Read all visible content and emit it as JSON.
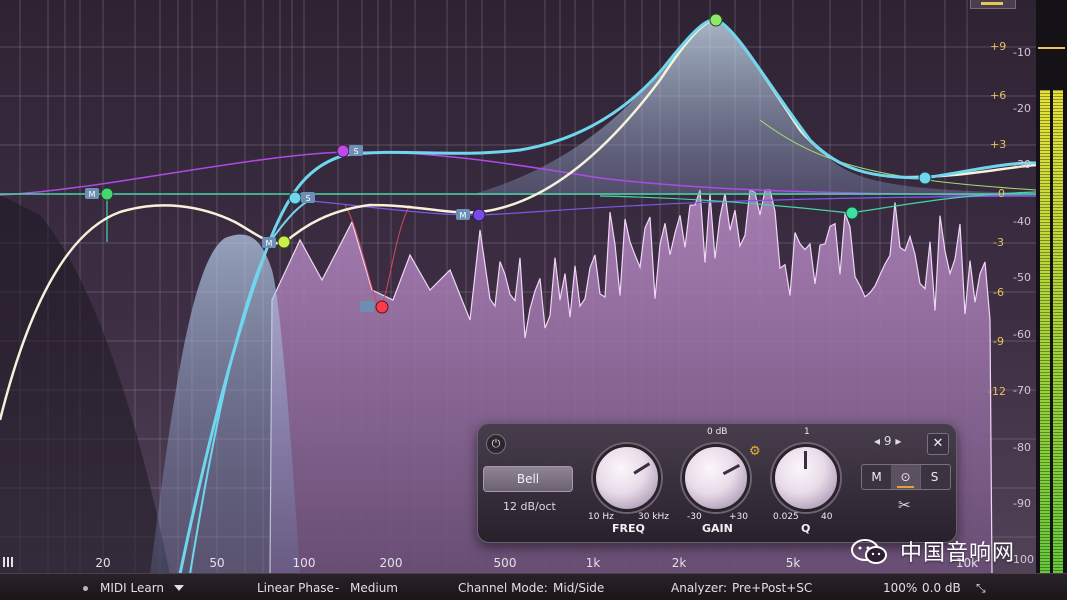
{
  "app": {
    "top_button": ""
  },
  "graph": {
    "x_ticks": [
      "20",
      "50",
      "100",
      "200",
      "500",
      "1k",
      "2k",
      "5k",
      "10k"
    ],
    "gain_ticks": [
      "+9",
      "+6",
      "+3",
      "0",
      "-3",
      "-6",
      "-9",
      "-12"
    ],
    "db_ticks": [
      "-10",
      "-20",
      "-30",
      "-40",
      "-50",
      "-60",
      "-70",
      "-80",
      "-90",
      "-100"
    ],
    "node_labels": {
      "band1": "M",
      "band2": "M",
      "band3": "S",
      "band4": "S",
      "band5": "M",
      "band6": "M"
    }
  },
  "panel": {
    "shape": "Bell",
    "slope": "12 dB/oct",
    "freq": {
      "label": "FREQ",
      "min": "10 Hz",
      "max": "30 kHz"
    },
    "gain": {
      "label": "GAIN",
      "top": "0 dB",
      "min": "-30",
      "max": "+30"
    },
    "q": {
      "label": "Q",
      "top": "1",
      "min": "0.025",
      "max": "40"
    },
    "band_number": "9",
    "mode_m": "M",
    "mode_s": "S"
  },
  "bottom_bar": {
    "midi_learn": "MIDI Learn",
    "phase_mode": "Linear Phase",
    "phase_sep": "-",
    "phase_quality": "Medium",
    "channel_mode_label": "Channel Mode:",
    "channel_mode_value": "Mid/Side",
    "analyzer_label": "Analyzer:",
    "analyzer_value": "Pre+Post+SC",
    "zoom": "100%",
    "output_gain": "0.0 dB"
  },
  "watermark": {
    "text": "中国音响网"
  },
  "colors": {
    "accent": "#e7c35a",
    "curve_main": "#6fd6ee",
    "curve_white": "#f4f2da",
    "band_green": "#3ce0a0",
    "band_purple": "#a040e0",
    "band_red": "#ff3a4a",
    "spectrum": "#e6c8ee"
  }
}
